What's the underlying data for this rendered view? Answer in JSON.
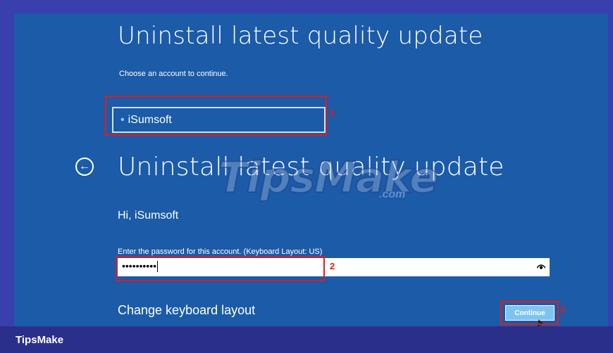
{
  "screen": {
    "title_top": "Uninstall latest quality update",
    "choose_account_text": "Choose an account to continue.",
    "account_name": "iSumsoft",
    "title_main": "Uninstall latest quality update",
    "greeting": "Hi, iSumsoft",
    "password_label": "Enter the password for this account. (Keyboard Layout: US)",
    "password_value": "••••••••••",
    "change_keyboard_layout": "Change keyboard layout",
    "continue_label": "Continue",
    "back_icon": "⊖",
    "eye_icon": "👁"
  },
  "annotations": {
    "step1": "1",
    "step2": "2",
    "step3": "3",
    "color": "#e21b1b"
  },
  "watermark": {
    "main": "TipsMake",
    "suffix": ".com"
  },
  "footer": {
    "brand": "TipsMake"
  },
  "colors": {
    "screen_bg": "#1b5ba8",
    "frame_bg": "#3a3fae",
    "footer_bg": "#2b2f8c",
    "button_bg": "#7fc4f0"
  }
}
